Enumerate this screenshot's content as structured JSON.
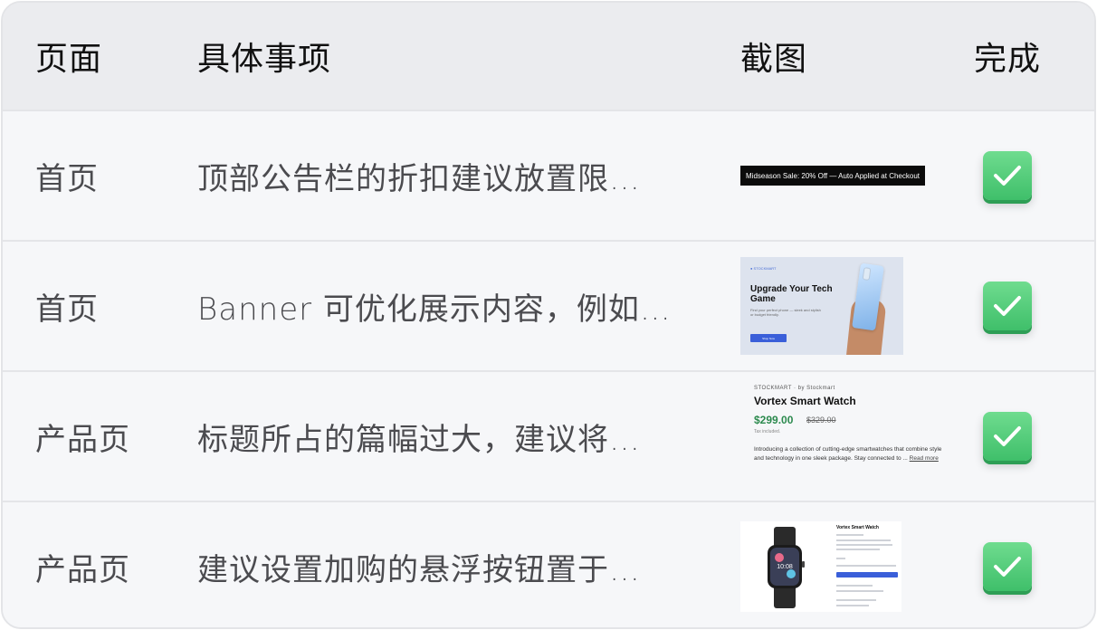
{
  "header": {
    "col_page": "页面",
    "col_item": "具体事项",
    "col_shot": "截图",
    "col_done": "完成"
  },
  "rows": [
    {
      "page": "首页",
      "item": "顶部公告栏的折扣建议放置限…",
      "done": true,
      "shot": {
        "kind": "announcement-bar",
        "text": "Midseason Sale: 20% Off — Auto Applied at Checkout"
      }
    },
    {
      "page": "首页",
      "item": "Banner 可优化展示内容，例如…",
      "done": true,
      "shot": {
        "kind": "hero-banner",
        "title": "Upgrade Your Tech Game",
        "brand": "● STOCKMART",
        "sub": "Find your perfect phone — sleek and stylish or budget friendly.",
        "button": "Shop Now"
      }
    },
    {
      "page": "产品页",
      "item": "标题所占的篇幅过大，建议将…",
      "done": true,
      "shot": {
        "kind": "product-info",
        "store": "STOCKMART  ·  by Stockmart",
        "name": "Vortex Smart Watch",
        "price": "$299.00",
        "old_price": "$329.00",
        "tax": "Tax included.",
        "desc": "Introducing a collection of cutting-edge smartwatches that combine style and technology in one sleek package. Stay connected to ...",
        "read_more": "Read more"
      }
    },
    {
      "page": "产品页",
      "item": "建议设置加购的悬浮按钮置于…",
      "done": true,
      "shot": {
        "kind": "product-page",
        "name": "Vortex Smart Watch",
        "time": "10:08"
      }
    }
  ],
  "colors": {
    "check": "#4cc875",
    "header_bg": "#ebecef",
    "row_bg": "#f6f7f9",
    "price": "#2c8a4e",
    "accent": "#3a5fd9"
  }
}
